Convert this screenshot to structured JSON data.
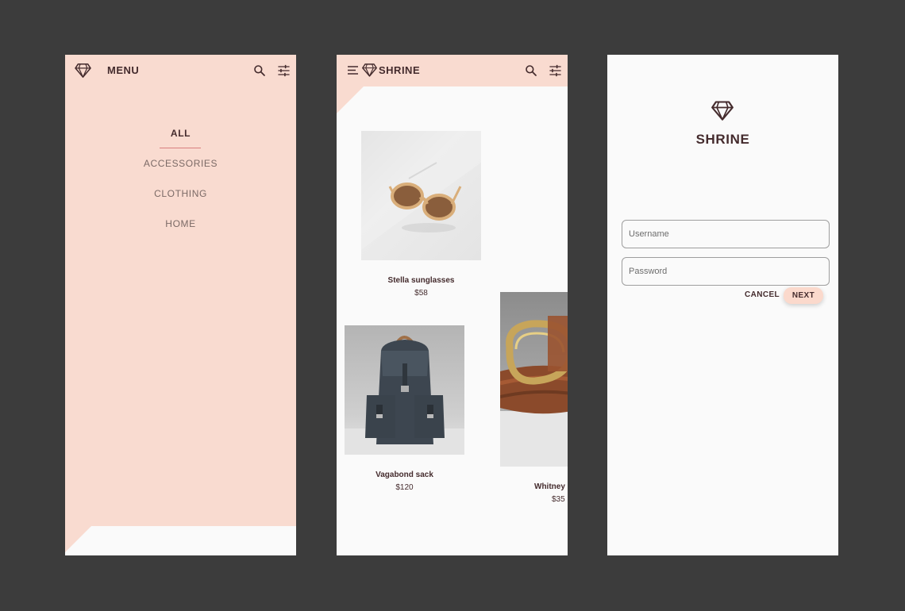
{
  "menu_screen": {
    "title": "MENU",
    "items": [
      {
        "label": "ALL",
        "active": true
      },
      {
        "label": "ACCESSORIES",
        "active": false
      },
      {
        "label": "CLOTHING",
        "active": false
      },
      {
        "label": "HOME",
        "active": false
      }
    ],
    "icons": [
      "diamond-logo-icon",
      "search-icon",
      "filter-icon"
    ]
  },
  "catalog_screen": {
    "title": "SHRINE",
    "icons": [
      "menu-icon",
      "diamond-logo-icon",
      "search-icon",
      "filter-icon"
    ],
    "products": [
      {
        "name": "Stella sunglasses",
        "price": "$58"
      },
      {
        "name": "Vagabond sack",
        "price": "$120"
      },
      {
        "name": "Whitney",
        "price": "$35"
      }
    ]
  },
  "login_screen": {
    "title": "SHRINE",
    "username_placeholder": "Username",
    "password_placeholder": "Password",
    "cancel_label": "CANCEL",
    "next_label": "NEXT"
  },
  "colors": {
    "background": "#3c3c3c",
    "primary_pink": "#f9dbd0",
    "surface": "#fafafa",
    "text_brown": "#442b2d",
    "accent_line": "#d87f7f"
  }
}
